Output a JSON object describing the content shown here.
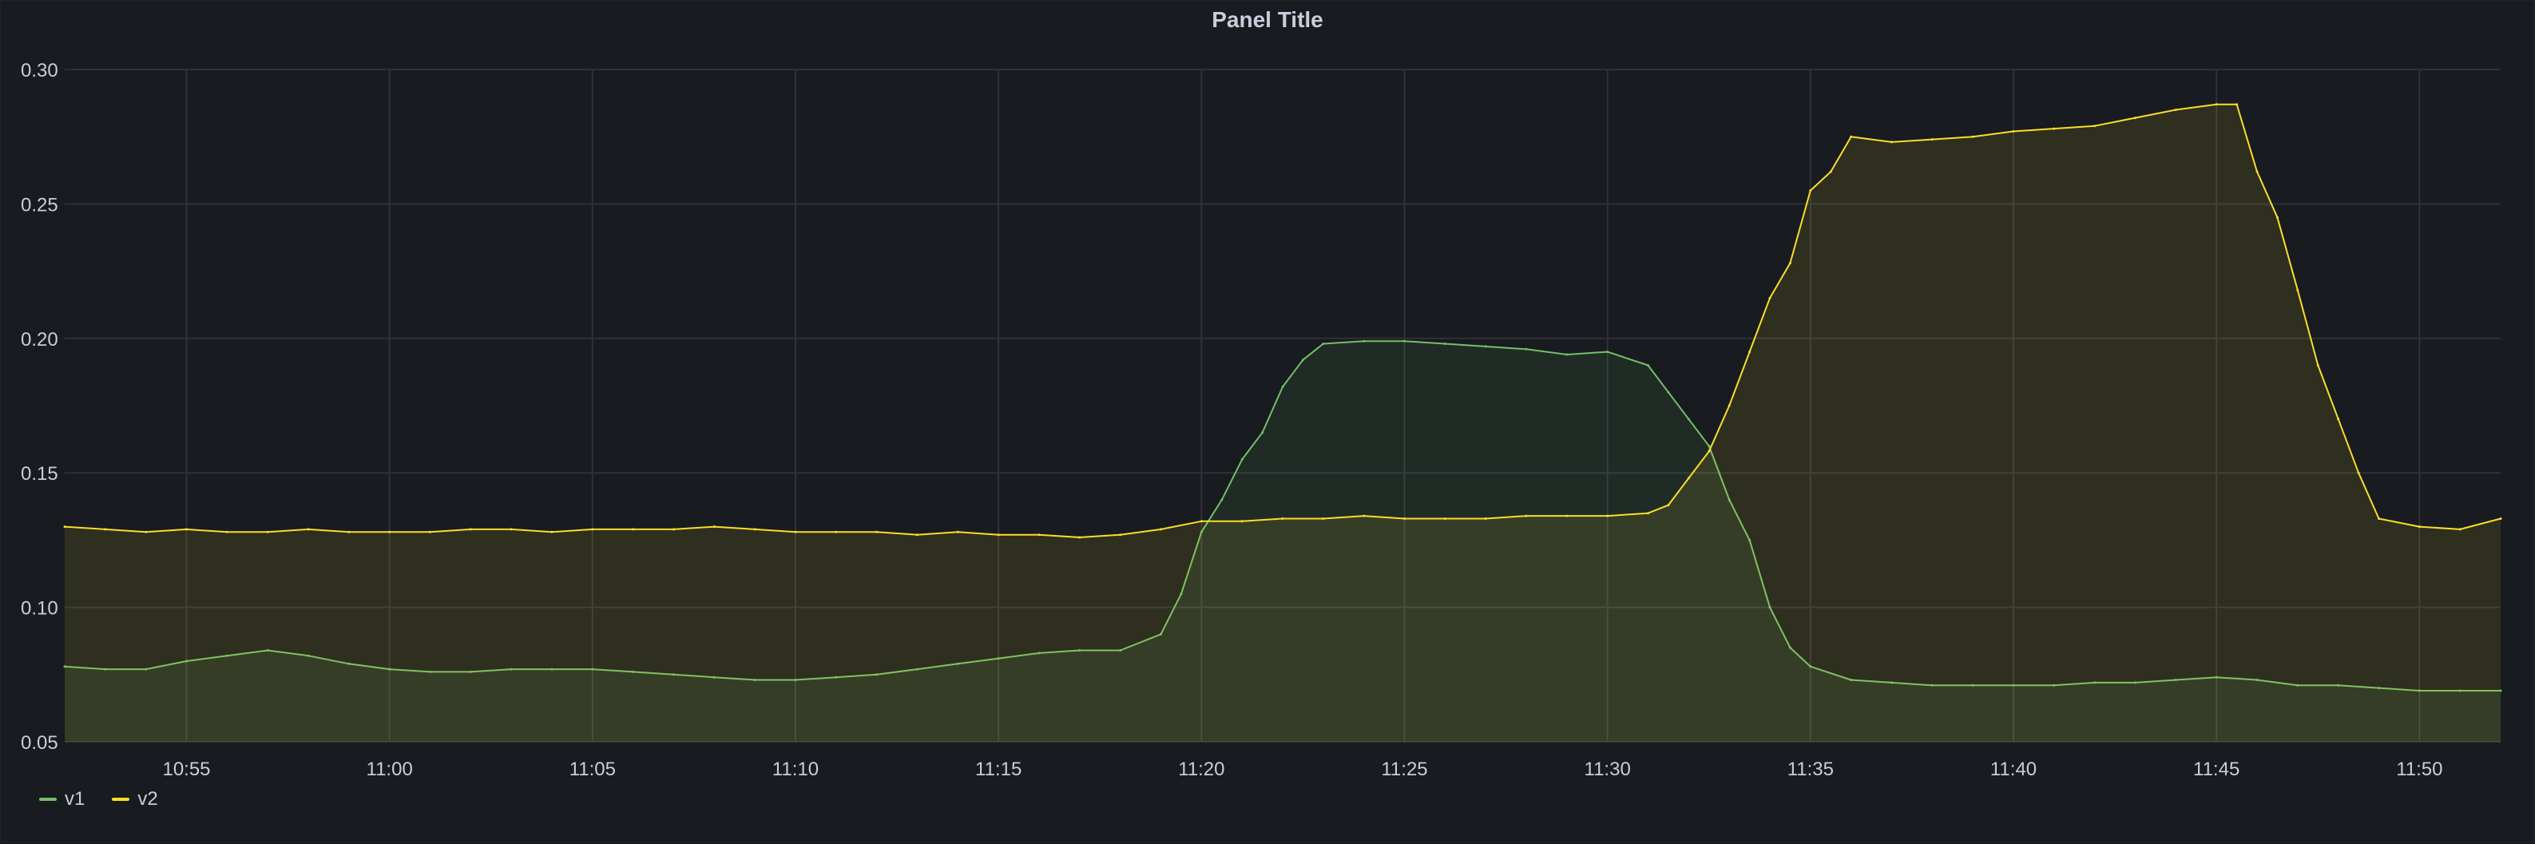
{
  "panel": {
    "title": "Panel Title"
  },
  "colors": {
    "v1": "#73bf69",
    "v2": "#fade2a",
    "grid": "#2f3136",
    "text": "#ccccdc"
  },
  "chart_data": {
    "type": "line",
    "title": "Panel Title",
    "xlabel": "",
    "ylabel": "",
    "ylim": [
      0.05,
      0.3
    ],
    "xlim": [
      "10:52",
      "11:52"
    ],
    "x_ticks": [
      "10:55",
      "11:00",
      "11:05",
      "11:10",
      "11:15",
      "11:20",
      "11:25",
      "11:30",
      "11:35",
      "11:40",
      "11:45",
      "11:50"
    ],
    "y_ticks": [
      "0.05",
      "0.10",
      "0.15",
      "0.20",
      "0.25",
      "0.30"
    ],
    "grid": true,
    "fill": "area",
    "legend": "bottom-left",
    "series": [
      {
        "name": "v1",
        "color": "#73bf69",
        "points": [
          [
            "10:52",
            0.078
          ],
          [
            "10:53",
            0.077
          ],
          [
            "10:54",
            0.077
          ],
          [
            "10:55",
            0.08
          ],
          [
            "10:56",
            0.082
          ],
          [
            "10:57",
            0.084
          ],
          [
            "10:58",
            0.082
          ],
          [
            "10:59",
            0.079
          ],
          [
            "11:00",
            0.077
          ],
          [
            "11:01",
            0.076
          ],
          [
            "11:02",
            0.076
          ],
          [
            "11:03",
            0.077
          ],
          [
            "11:04",
            0.077
          ],
          [
            "11:05",
            0.077
          ],
          [
            "11:06",
            0.076
          ],
          [
            "11:07",
            0.075
          ],
          [
            "11:08",
            0.074
          ],
          [
            "11:09",
            0.073
          ],
          [
            "11:10",
            0.073
          ],
          [
            "11:11",
            0.074
          ],
          [
            "11:12",
            0.075
          ],
          [
            "11:13",
            0.077
          ],
          [
            "11:14",
            0.079
          ],
          [
            "11:15",
            0.081
          ],
          [
            "11:16",
            0.083
          ],
          [
            "11:17",
            0.084
          ],
          [
            "11:18",
            0.084
          ],
          [
            "11:19",
            0.09
          ],
          [
            "11:19.5",
            0.105
          ],
          [
            "11:20",
            0.128
          ],
          [
            "11:20.5",
            0.14
          ],
          [
            "11:21",
            0.155
          ],
          [
            "11:21.5",
            0.165
          ],
          [
            "11:22",
            0.182
          ],
          [
            "11:22.5",
            0.192
          ],
          [
            "11:23",
            0.198
          ],
          [
            "11:24",
            0.199
          ],
          [
            "11:25",
            0.199
          ],
          [
            "11:26",
            0.198
          ],
          [
            "11:27",
            0.197
          ],
          [
            "11:28",
            0.196
          ],
          [
            "11:29",
            0.194
          ],
          [
            "11:30",
            0.195
          ],
          [
            "11:31",
            0.19
          ],
          [
            "11:31.5",
            0.18
          ],
          [
            "11:32",
            0.17
          ],
          [
            "11:32.5",
            0.16
          ],
          [
            "11:33",
            0.14
          ],
          [
            "11:33.5",
            0.125
          ],
          [
            "11:34",
            0.1
          ],
          [
            "11:34.5",
            0.085
          ],
          [
            "11:35",
            0.078
          ],
          [
            "11:36",
            0.073
          ],
          [
            "11:37",
            0.072
          ],
          [
            "11:38",
            0.071
          ],
          [
            "11:39",
            0.071
          ],
          [
            "11:40",
            0.071
          ],
          [
            "11:41",
            0.071
          ],
          [
            "11:42",
            0.072
          ],
          [
            "11:43",
            0.072
          ],
          [
            "11:44",
            0.073
          ],
          [
            "11:45",
            0.074
          ],
          [
            "11:46",
            0.073
          ],
          [
            "11:47",
            0.071
          ],
          [
            "11:48",
            0.071
          ],
          [
            "11:49",
            0.07
          ],
          [
            "11:50",
            0.069
          ],
          [
            "11:51",
            0.069
          ],
          [
            "11:52",
            0.069
          ]
        ]
      },
      {
        "name": "v2",
        "color": "#fade2a",
        "points": [
          [
            "10:52",
            0.13
          ],
          [
            "10:53",
            0.129
          ],
          [
            "10:54",
            0.128
          ],
          [
            "10:55",
            0.129
          ],
          [
            "10:56",
            0.128
          ],
          [
            "10:57",
            0.128
          ],
          [
            "10:58",
            0.129
          ],
          [
            "10:59",
            0.128
          ],
          [
            "11:00",
            0.128
          ],
          [
            "11:01",
            0.128
          ],
          [
            "11:02",
            0.129
          ],
          [
            "11:03",
            0.129
          ],
          [
            "11:04",
            0.128
          ],
          [
            "11:05",
            0.129
          ],
          [
            "11:06",
            0.129
          ],
          [
            "11:07",
            0.129
          ],
          [
            "11:08",
            0.13
          ],
          [
            "11:09",
            0.129
          ],
          [
            "11:10",
            0.128
          ],
          [
            "11:11",
            0.128
          ],
          [
            "11:12",
            0.128
          ],
          [
            "11:13",
            0.127
          ],
          [
            "11:14",
            0.128
          ],
          [
            "11:15",
            0.127
          ],
          [
            "11:16",
            0.127
          ],
          [
            "11:17",
            0.126
          ],
          [
            "11:18",
            0.127
          ],
          [
            "11:19",
            0.129
          ],
          [
            "11:20",
            0.132
          ],
          [
            "11:21",
            0.132
          ],
          [
            "11:22",
            0.133
          ],
          [
            "11:23",
            0.133
          ],
          [
            "11:24",
            0.134
          ],
          [
            "11:25",
            0.133
          ],
          [
            "11:26",
            0.133
          ],
          [
            "11:27",
            0.133
          ],
          [
            "11:28",
            0.134
          ],
          [
            "11:29",
            0.134
          ],
          [
            "11:30",
            0.134
          ],
          [
            "11:31",
            0.135
          ],
          [
            "11:31.5",
            0.138
          ],
          [
            "11:32",
            0.148
          ],
          [
            "11:32.5",
            0.158
          ],
          [
            "11:33",
            0.175
          ],
          [
            "11:33.5",
            0.195
          ],
          [
            "11:34",
            0.215
          ],
          [
            "11:34.5",
            0.228
          ],
          [
            "11:35",
            0.255
          ],
          [
            "11:35.5",
            0.262
          ],
          [
            "11:36",
            0.275
          ],
          [
            "11:37",
            0.273
          ],
          [
            "11:38",
            0.274
          ],
          [
            "11:39",
            0.275
          ],
          [
            "11:40",
            0.277
          ],
          [
            "11:41",
            0.278
          ],
          [
            "11:42",
            0.279
          ],
          [
            "11:43",
            0.282
          ],
          [
            "11:44",
            0.285
          ],
          [
            "11:45",
            0.287
          ],
          [
            "11:45.5",
            0.287
          ],
          [
            "11:46",
            0.262
          ],
          [
            "11:46.5",
            0.245
          ],
          [
            "11:47",
            0.218
          ],
          [
            "11:47.5",
            0.19
          ],
          [
            "11:48",
            0.17
          ],
          [
            "11:48.5",
            0.15
          ],
          [
            "11:49",
            0.133
          ],
          [
            "11:50",
            0.13
          ],
          [
            "11:51",
            0.129
          ],
          [
            "11:52",
            0.133
          ]
        ]
      }
    ]
  }
}
